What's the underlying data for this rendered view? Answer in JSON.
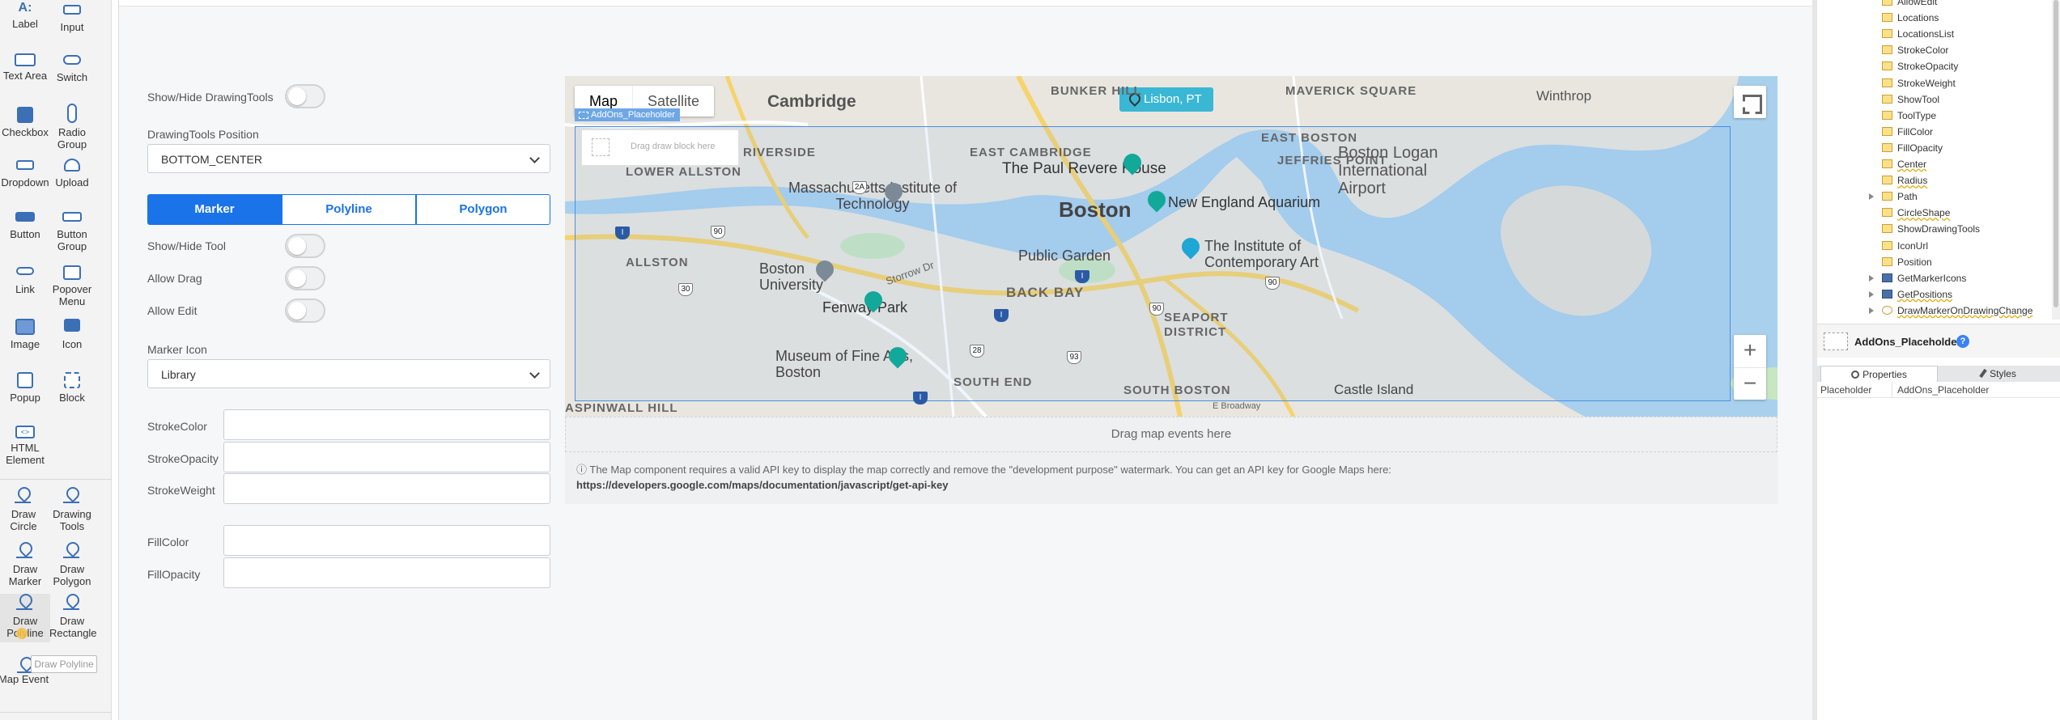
{
  "palette": {
    "items": [
      {
        "label": "Label"
      },
      {
        "label": "Input"
      },
      {
        "label": "Text Area"
      },
      {
        "label": "Switch"
      },
      {
        "label": "Checkbox"
      },
      {
        "label": "Radio Group"
      },
      {
        "label": "Dropdown"
      },
      {
        "label": "Upload"
      },
      {
        "label": "Button"
      },
      {
        "label": "Button Group"
      },
      {
        "label": "Link"
      },
      {
        "label": "Popover Menu"
      },
      {
        "label": "Image"
      },
      {
        "label": "Icon"
      },
      {
        "label": "Popup"
      },
      {
        "label": "Block"
      },
      {
        "label": "HTML Element"
      }
    ],
    "map_items": [
      {
        "label": "Draw Circle"
      },
      {
        "label": "Drawing Tools"
      },
      {
        "label": "Draw Marker"
      },
      {
        "label": "Draw Polygon"
      },
      {
        "label": "Draw Polyline"
      },
      {
        "label": "Draw Rectangle"
      },
      {
        "label": "Map Event"
      }
    ],
    "drag_tooltip": "Draw Polyline"
  },
  "form": {
    "show_hide_drawing_tools": "Show/Hide DrawingTools",
    "drawing_tools_position_label": "DrawingTools Position",
    "drawing_tools_position_value": "BOTTOM_CENTER",
    "segments": [
      "Marker",
      "Polyline",
      "Polygon"
    ],
    "active_segment": "Marker",
    "show_hide_tool": "Show/Hide Tool",
    "allow_drag": "Allow Drag",
    "allow_edit": "Allow Edit",
    "marker_icon_label": "Marker Icon",
    "marker_icon_value": "Library",
    "stroke_color": "StrokeColor",
    "stroke_opacity": "StrokeOpacity",
    "stroke_weight": "StrokeWeight",
    "fill_color": "FillColor",
    "fill_opacity": "FillOpacity"
  },
  "map": {
    "type_map": "Map",
    "type_satellite": "Satellite",
    "city_pin": "Lisbon, PT",
    "placeholder_tag": "AddOns_Placeholder",
    "drag_block": "Drag draw block here",
    "labels": {
      "cambridge": "Cambridge",
      "bunker_hill": "BUNKER HILL",
      "maverick": "MAVERICK SQUARE",
      "winthrop": "Winthrop",
      "east_boston": "EAST BOSTON",
      "east_cambridge": "EAST CAMBRIDGE",
      "jeffries_point": "JEFFRIES POINT",
      "riverside": "RIVERSIDE",
      "lower_allston": "LOWER ALLSTON",
      "paul_revere": "The Paul Revere House",
      "logan": "Boston Logan International Airport",
      "mit": "Massachusetts Institute of Technology",
      "boston": "Boston",
      "aquarium": "New England Aquarium",
      "allston": "ALLSTON",
      "public_garden": "Public Garden",
      "ica": "The Institute of Contemporary Art",
      "bu": "Boston University",
      "storrow": "Storrow Dr",
      "back_bay": "BACK BAY",
      "fenway": "Fenway Park",
      "seaport": "SEAPORT DISTRICT",
      "mfa": "Museum of Fine Arts, Boston",
      "south_end": "SOUTH END",
      "south_boston": "SOUTH BOSTON",
      "castle_island": "Castle Island",
      "aspinwall": "ASPINWALL HILL",
      "e_broadway": "E Broadway"
    },
    "drag_events": "Drag map events here",
    "notice_text": "ⓘ The Map component requires a valid API key to display the map correctly and remove the \"development purpose\" watermark. You can get an API key for Google Maps here:",
    "notice_link": "https://developers.google.com/maps/documentation/javascript/get-api-key"
  },
  "tree": {
    "rows": [
      {
        "label": "AllowEdit",
        "icon": "folder"
      },
      {
        "label": "Locations",
        "icon": "folder"
      },
      {
        "label": "LocationsList",
        "icon": "folder"
      },
      {
        "label": "StrokeColor",
        "icon": "folder"
      },
      {
        "label": "StrokeOpacity",
        "icon": "folder"
      },
      {
        "label": "StrokeWeight",
        "icon": "folder"
      },
      {
        "label": "ShowTool",
        "icon": "folder"
      },
      {
        "label": "ToolType",
        "icon": "folder"
      },
      {
        "label": "FillColor",
        "icon": "folder"
      },
      {
        "label": "FillOpacity",
        "icon": "folder"
      },
      {
        "label": "Center",
        "icon": "folder"
      },
      {
        "label": "Radius",
        "icon": "folder"
      },
      {
        "label": "Path",
        "icon": "folder"
      },
      {
        "label": "CircleShape",
        "icon": "folder"
      },
      {
        "label": "ShowDrawingTools",
        "icon": "folder"
      },
      {
        "label": "IconUrl",
        "icon": "folder"
      },
      {
        "label": "Position",
        "icon": "folder"
      },
      {
        "label": "GetMarkerIcons",
        "icon": "grid"
      },
      {
        "label": "GetPositions",
        "icon": "grid"
      },
      {
        "label": "DrawMarkerOnDrawingChange",
        "icon": "circle"
      }
    ]
  },
  "inspector": {
    "selected": "AddOns_Placeholder",
    "tab_properties": "Properties",
    "tab_styles": "Styles",
    "prop_name": "Placeholder",
    "prop_value": "AddOns_Placeholder"
  },
  "colors": {
    "accent": "#1a73e8",
    "water": "#a9d1ee"
  }
}
